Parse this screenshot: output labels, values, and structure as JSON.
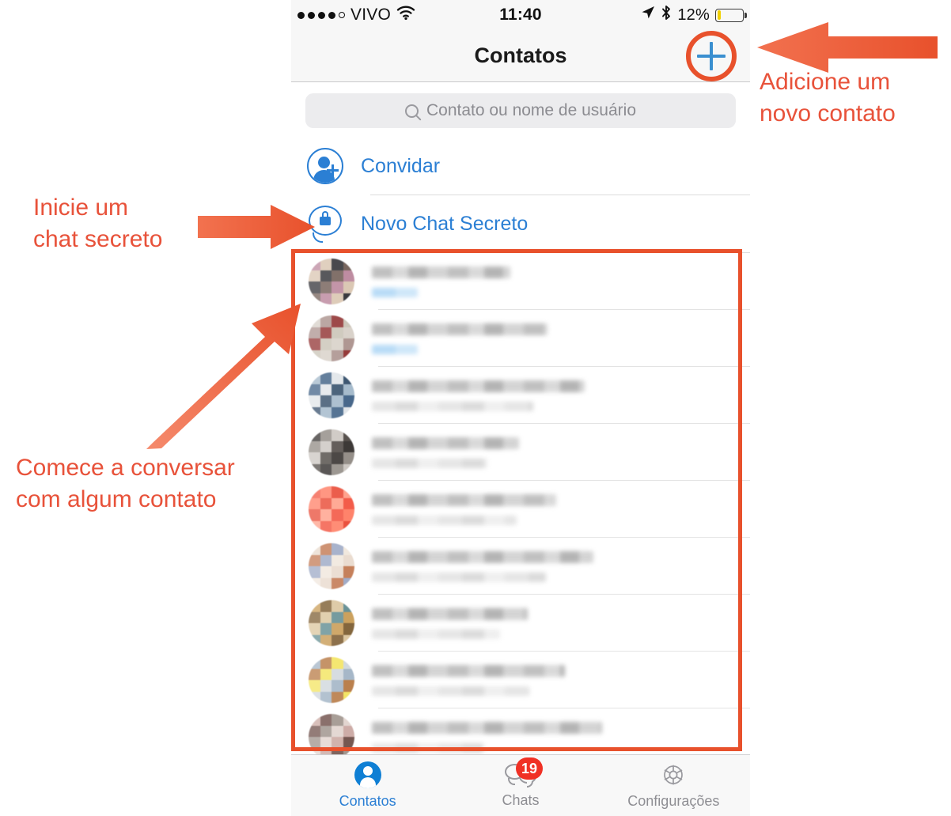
{
  "status_bar": {
    "signal_dots_filled": 4,
    "signal_dots_total": 5,
    "carrier": "VIVO",
    "wifi_icon": "wifi-icon",
    "time": "11:40",
    "location_icon": "location-arrow-icon",
    "bluetooth_icon": "bluetooth-icon",
    "battery_percent": "12%",
    "battery_level": 12
  },
  "navbar": {
    "title": "Contatos",
    "add_button_icon": "plus-icon"
  },
  "search": {
    "placeholder": "Contato ou nome de usuário",
    "icon": "search-icon"
  },
  "actions": [
    {
      "label": "Convidar",
      "icon": "person-add-icon"
    },
    {
      "label": "Novo Chat Secreto",
      "icon": "lock-chat-icon"
    }
  ],
  "contacts": [
    {
      "name": "",
      "status": "",
      "online": true,
      "avatar_colors": [
        "#b9839a",
        "#d8c4ae",
        "#2b2b30",
        "#6e5a52"
      ]
    },
    {
      "name": "",
      "status": "",
      "online": true,
      "avatar_colors": [
        "#d6cfc6",
        "#a98f8a",
        "#8d2b2b",
        "#c8c2b4"
      ]
    },
    {
      "name": "",
      "status": "",
      "online": false,
      "avatar_colors": [
        "#9fb6c8",
        "#3a5d82",
        "#e0e4e8",
        "#2f4a66"
      ]
    },
    {
      "name": "",
      "status": "",
      "online": false,
      "avatar_colors": [
        "#2e2a28",
        "#8d8780",
        "#c9c4be",
        "#4a4440"
      ]
    },
    {
      "name": "",
      "status": "",
      "online": false,
      "avatar_colors": [
        "#f2503c",
        "#ff7a60",
        "#e8442f",
        "#ff9c85"
      ]
    },
    {
      "name": "",
      "status": "",
      "online": false,
      "avatar_colors": [
        "#e8d9cc",
        "#c1764f",
        "#9aa6c4",
        "#f0e6dc"
      ]
    },
    {
      "name": "",
      "status": "",
      "online": false,
      "avatar_colors": [
        "#c79a52",
        "#7a5a2e",
        "#d9c39a",
        "#5e8a8f"
      ]
    },
    {
      "name": "",
      "status": "",
      "online": false,
      "avatar_colors": [
        "#9fb2c4",
        "#b5763f",
        "#f2e35a",
        "#cfd6dc"
      ]
    },
    {
      "name": "",
      "status": "",
      "online": false,
      "avatar_colors": [
        "#c9a6a0",
        "#6a4a44",
        "#9a8e86",
        "#e0d2cc"
      ]
    }
  ],
  "tabbar": [
    {
      "label": "Contatos",
      "icon": "contacts-icon",
      "active": true,
      "badge": ""
    },
    {
      "label": "Chats",
      "icon": "chats-icon",
      "active": false,
      "badge": "19"
    },
    {
      "label": "Configurações",
      "icon": "gear-icon",
      "active": false,
      "badge": ""
    }
  ],
  "annotations": {
    "add_contact": "Adicione um\nnovo contato",
    "secret_chat": "Inicie um\nchat secreto",
    "start_conversation": "Comece a conversar\ncom algum contato"
  },
  "colors": {
    "accent_orange": "#e8512c",
    "annotation_text": "#e8523a",
    "link_blue": "#2b7fd4",
    "badge_red": "#f03125",
    "tab_inactive": "#8e8e93"
  }
}
